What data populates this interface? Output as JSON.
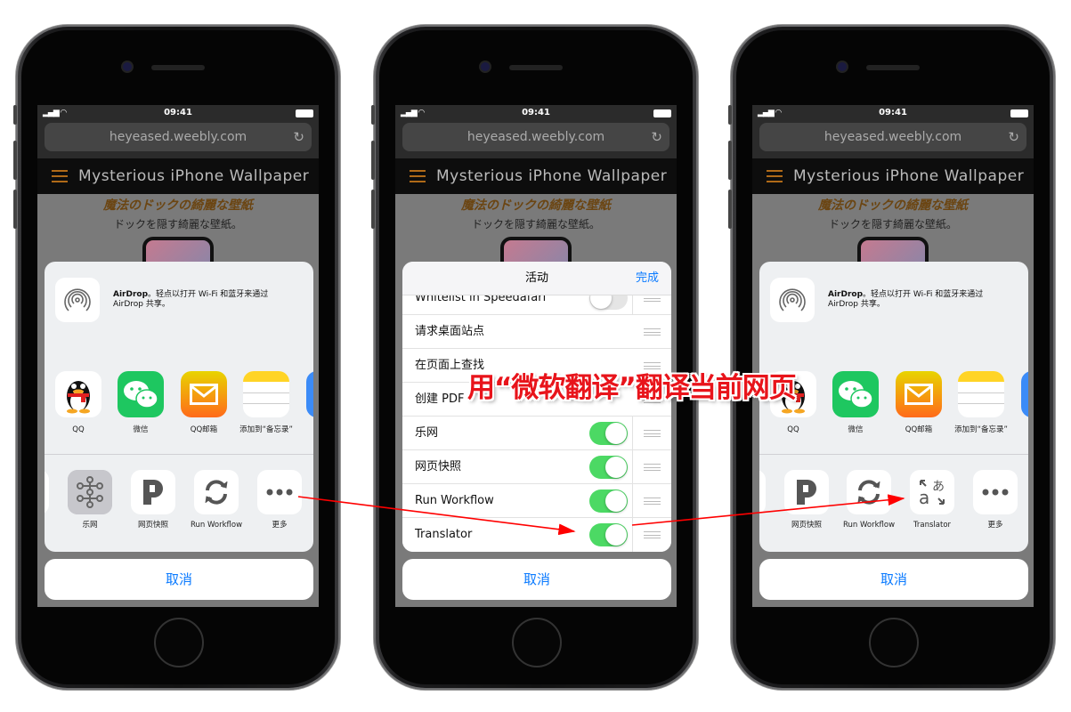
{
  "phones": [
    {
      "status": {
        "time": "09:41"
      },
      "url": "heyeased.weebly.com",
      "site_title": "Mysterious iPhone Wallpaper",
      "heading": "魔法のドックの綺麗な壁紙",
      "subheading": "ドックを隠す綺麗な壁紙。",
      "airdrop": {
        "title": "AirDrop",
        "text": "。轻点以打开 Wi-Fi 和蓝牙来通过 AirDrop 共享。"
      },
      "apps": [
        {
          "label": "QQ",
          "icon": "qq-penguin-icon"
        },
        {
          "label": "微信",
          "icon": "wechat-icon"
        },
        {
          "label": "QQ邮箱",
          "icon": "qq-mail-icon"
        },
        {
          "label": "添加到“备忘录”",
          "icon": "notes-icon"
        }
      ],
      "actions": [
        {
          "label": "乐网",
          "icon": "lewang-icon"
        },
        {
          "label": "网页快照",
          "icon": "web-snapshot-icon"
        },
        {
          "label": "Run Workflow",
          "icon": "run-workflow-icon"
        },
        {
          "label": "更多",
          "icon": "more-icon"
        }
      ],
      "cancel": "取消"
    },
    {
      "status": {
        "time": "09:41"
      },
      "url": "heyeased.weebly.com",
      "site_title": "Mysterious iPhone Wallpaper",
      "heading": "魔法のドックの綺麗な壁紙",
      "subheading": "ドックを隠す綺麗な壁紙。",
      "activity": {
        "title": "活动",
        "done": "完成",
        "rows": [
          {
            "label": "Whitelist in Speedafari",
            "toggle": false
          },
          {
            "label": "请求桌面站点",
            "toggle": null
          },
          {
            "label": "在页面上查找",
            "toggle": null
          },
          {
            "label": "创建 PDF",
            "toggle": null
          },
          {
            "label": "乐网",
            "toggle": true
          },
          {
            "label": "网页快照",
            "toggle": true
          },
          {
            "label": "Run Workflow",
            "toggle": true
          },
          {
            "label": "Translator",
            "toggle": true
          }
        ]
      },
      "cancel": "取消"
    },
    {
      "status": {
        "time": "09:41"
      },
      "url": "heyeased.weebly.com",
      "site_title": "Mysterious iPhone Wallpaper",
      "heading": "魔法のドックの綺麗な壁紙",
      "subheading": "ドックを隠す綺麗な壁紙。",
      "airdrop": {
        "title": "AirDrop",
        "text": "。轻点以打开 Wi-Fi 和蓝牙来通过 AirDrop 共享。"
      },
      "apps": [
        {
          "label": "QQ",
          "icon": "qq-penguin-icon"
        },
        {
          "label": "微信",
          "icon": "wechat-icon"
        },
        {
          "label": "QQ邮箱",
          "icon": "qq-mail-icon"
        },
        {
          "label": "添加到“备忘录”",
          "icon": "notes-icon"
        }
      ],
      "actions": [
        {
          "label": "网页快照",
          "icon": "web-snapshot-icon"
        },
        {
          "label": "Run Workflow",
          "icon": "run-workflow-icon"
        },
        {
          "label": "Translator",
          "icon": "translator-icon"
        },
        {
          "label": "更多",
          "icon": "more-icon"
        }
      ],
      "cancel": "取消"
    }
  ],
  "annotation": "用“微软翻译”翻译当前网页",
  "colors": {
    "accent": "#0a7aff",
    "toggle_on": "#4cd964",
    "annotation": "#e8141b"
  }
}
